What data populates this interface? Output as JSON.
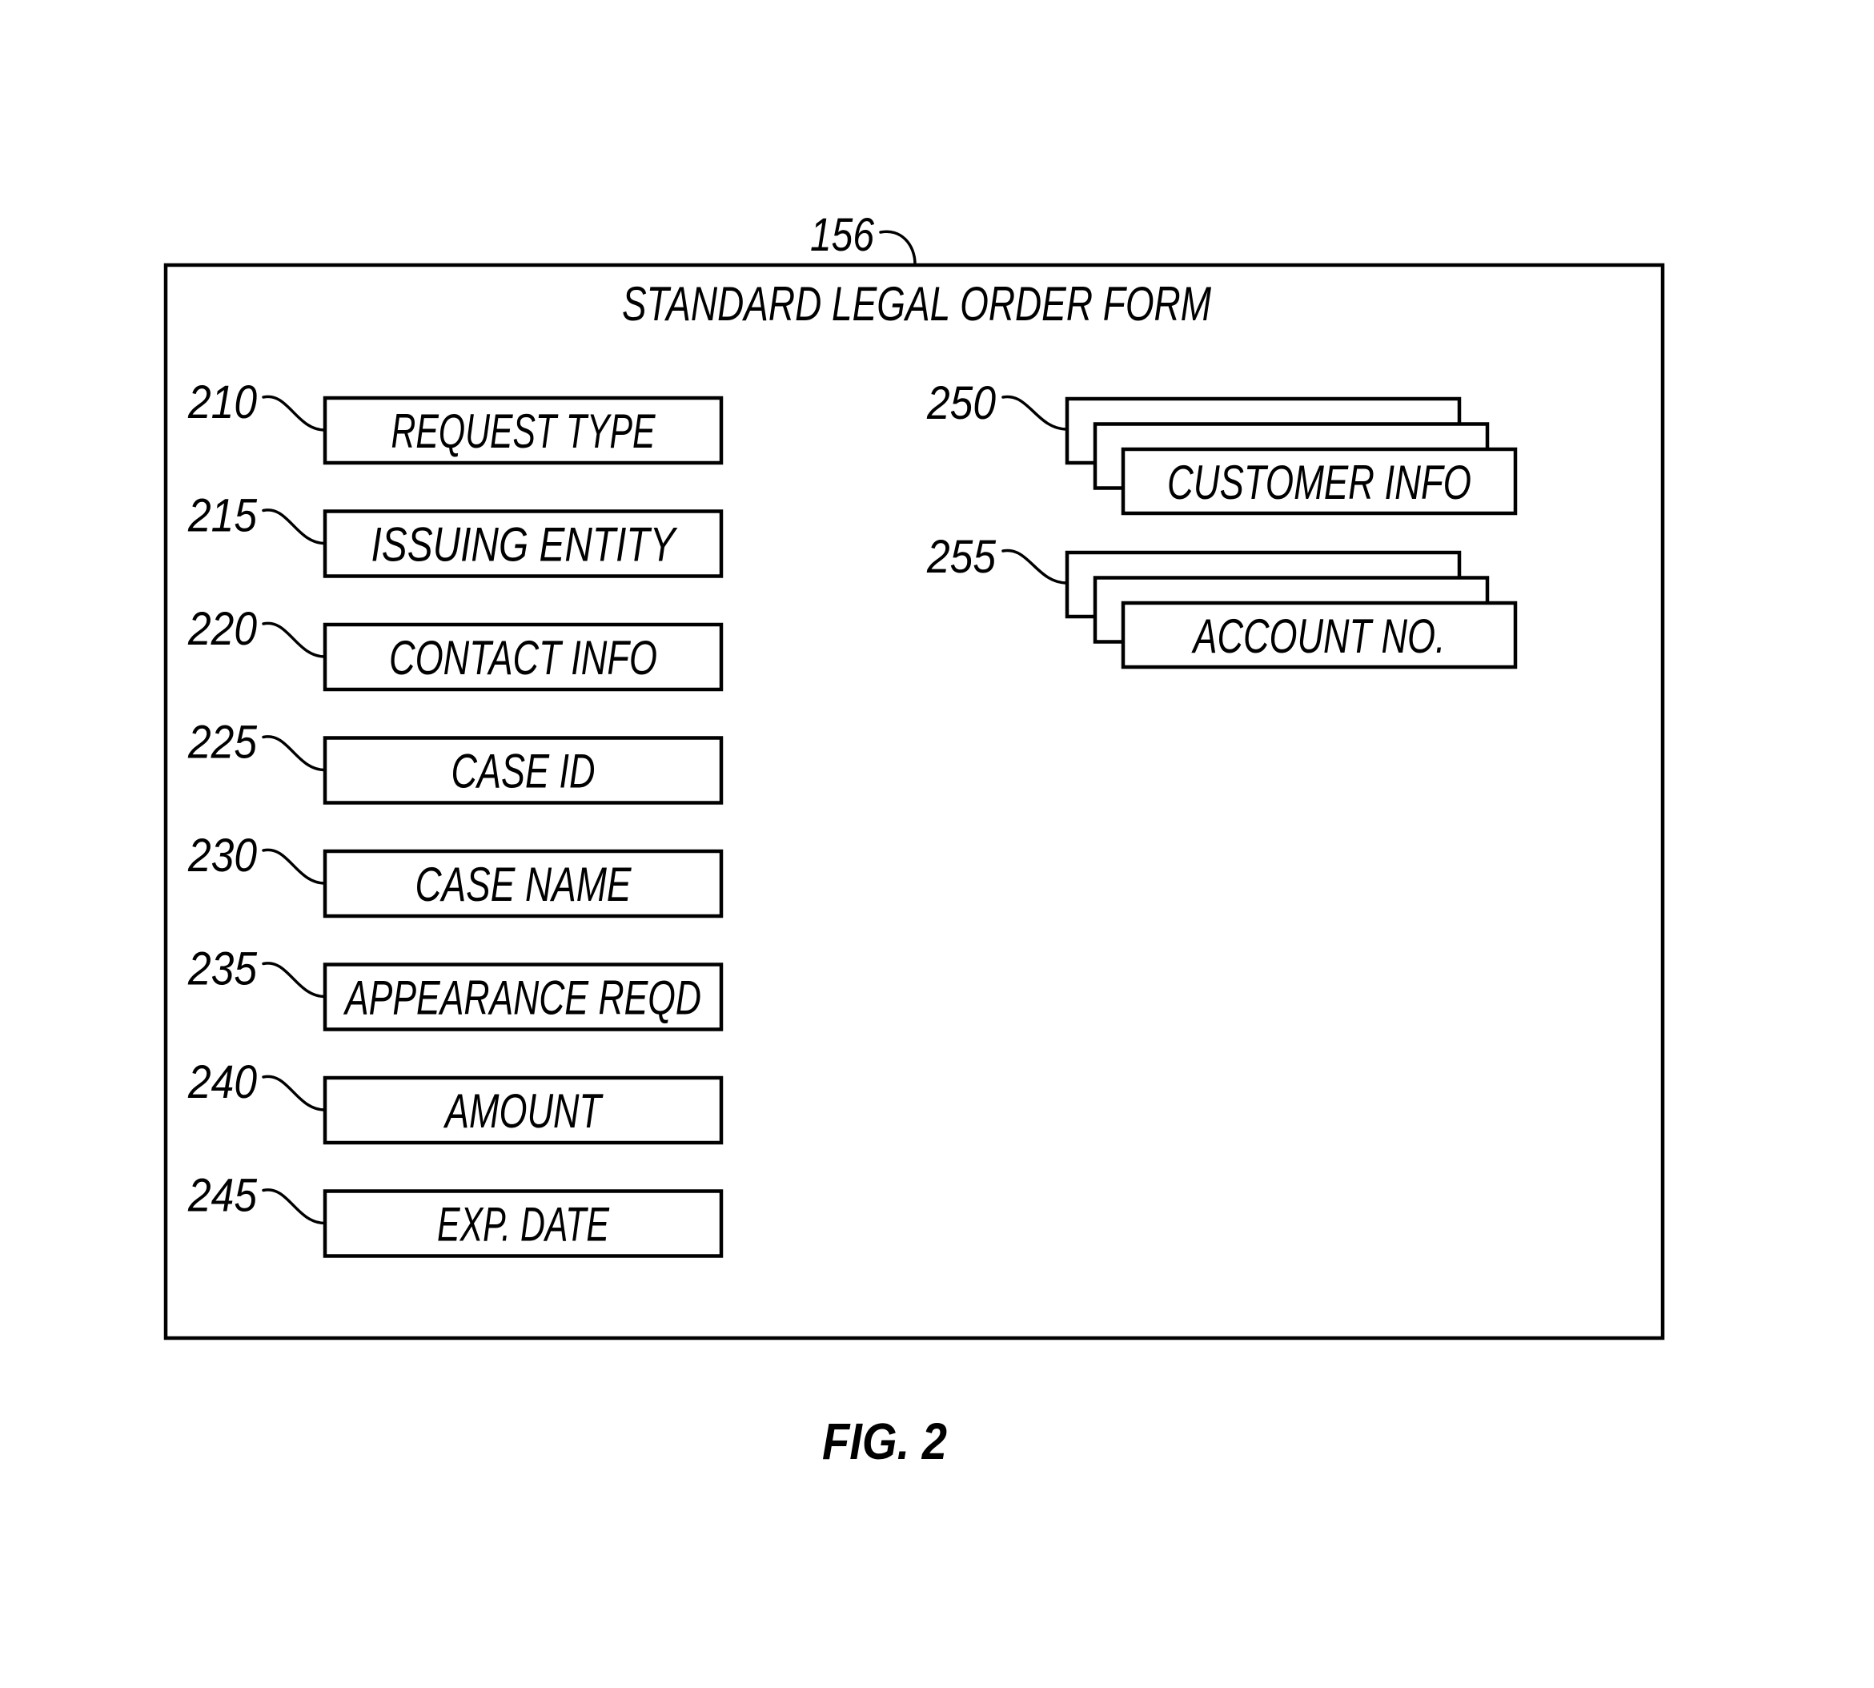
{
  "figure": {
    "caption": "FIG. 2",
    "form": {
      "ref": "156",
      "title": "STANDARD LEGAL ORDER FORM"
    },
    "fields": [
      {
        "ref": "210",
        "label": "REQUEST TYPE"
      },
      {
        "ref": "215",
        "label": "ISSUING ENTITY"
      },
      {
        "ref": "220",
        "label": "CONTACT INFO"
      },
      {
        "ref": "225",
        "label": "CASE ID"
      },
      {
        "ref": "230",
        "label": "CASE NAME"
      },
      {
        "ref": "235",
        "label": "APPEARANCE REQD"
      },
      {
        "ref": "240",
        "label": "AMOUNT"
      },
      {
        "ref": "245",
        "label": "EXP. DATE"
      }
    ],
    "stacked_fields": [
      {
        "ref": "250",
        "label": "CUSTOMER INFO"
      },
      {
        "ref": "255",
        "label": "ACCOUNT NO."
      }
    ]
  }
}
